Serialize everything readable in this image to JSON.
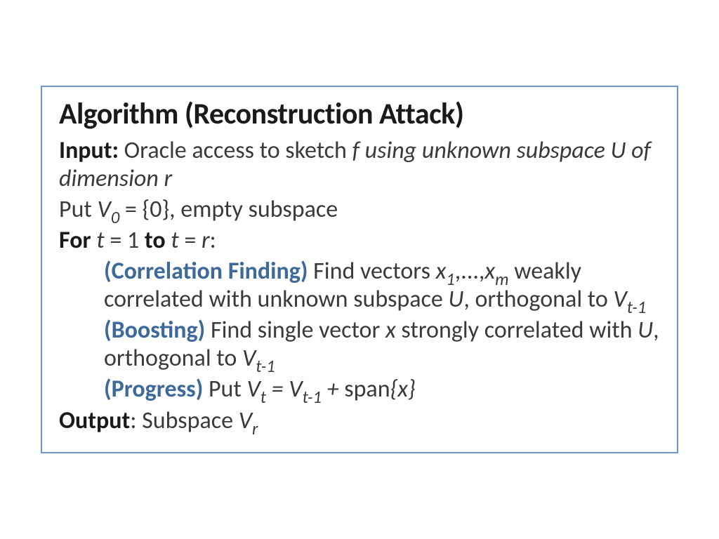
{
  "title": "Algorithm (Reconstruction Attack)",
  "input": {
    "label": "Input:",
    "text_prefix": " Oracle access to sketch ",
    "text_italic": "f using unknown subspace U of dimension r"
  },
  "init": {
    "prefix": "Put ",
    "var": "V",
    "sub": "0",
    "rest": " = {0}, empty subspace"
  },
  "for": {
    "for_label": "For",
    "t1": " t",
    "eq1": " = 1 ",
    "to_label": "to",
    "t2": " t",
    "eq2": " = ",
    "r": "r",
    "colon": ":"
  },
  "corr": {
    "label": "(Correlation Finding)",
    "text1": " Find vectors ",
    "x1": "x",
    "s1": "1",
    "dots": ",...,",
    "xm": "x",
    "sm": "m",
    "text2": " weakly correlated with unknown subspace ",
    "U": "U",
    "text3": ", orthogonal to ",
    "V": "V",
    "Vsub": "t-1"
  },
  "boost": {
    "label": "(Boosting)",
    "text1": " Find single vector ",
    "x": "x",
    "text2": " strongly correlated with ",
    "U": "U",
    "text3": ", orthogonal to ",
    "V": "V",
    "Vsub": "t-1"
  },
  "progress": {
    "label": "(Progress)",
    "text1": " Put ",
    "Vt": "V",
    "Vtsub": "t",
    "eq": " = ",
    "Vtm1": "V",
    "Vtm1sub": "t-1",
    "plus": " + ",
    "span_word": "span",
    "braces": "{x}"
  },
  "output": {
    "label": "Output",
    "colon": ": Subspace ",
    "V": "V",
    "Vsub": "r"
  }
}
